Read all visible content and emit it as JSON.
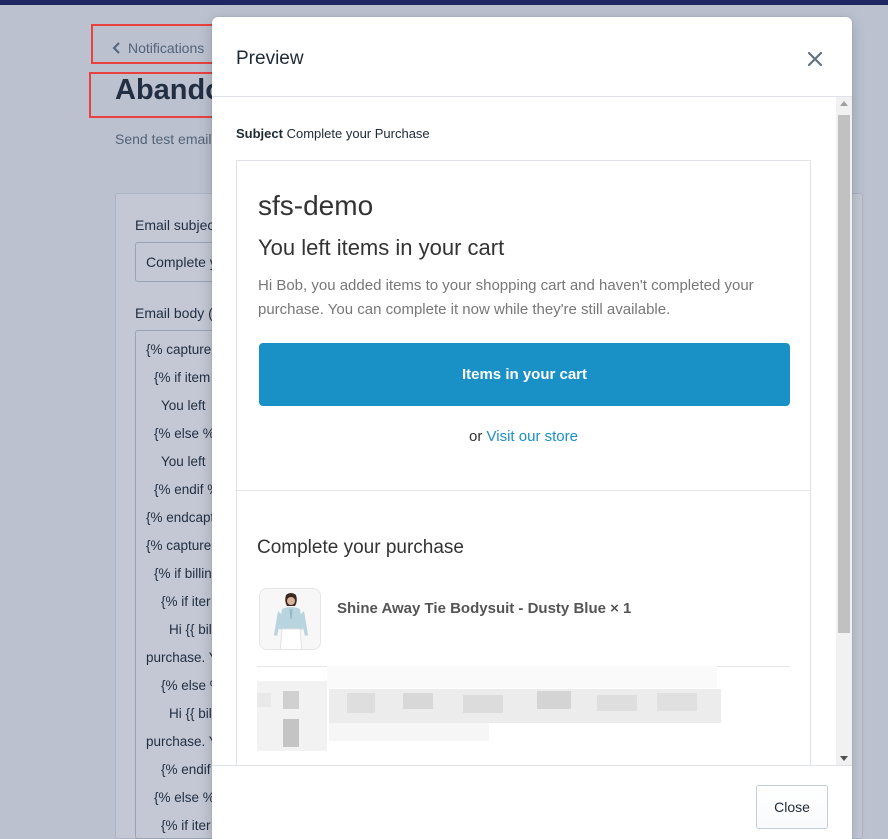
{
  "background": {
    "breadcrumb_label": "Notifications",
    "page_title": "Abando",
    "send_test_text": "Send test email",
    "email_subject_label": "Email subjec",
    "email_subject_value": "Complete y",
    "email_body_label": "Email body (",
    "code_lines": [
      "{% capture",
      "{% if item",
      "You left",
      "{% else %",
      "You left",
      "{% endif %",
      "{% endcapt",
      "{% capture",
      "{% if billin",
      "{% if iter",
      "Hi {{ bil",
      "purchase. Y",
      "{% else %",
      "Hi {{ bil",
      "purchase. Y",
      "{% endif",
      "{% else %",
      "{% if iter"
    ]
  },
  "modal": {
    "title": "Preview",
    "subject_prefix": "Subject",
    "subject_value": "Complete your Purchase",
    "email": {
      "shop_name": "sfs-demo",
      "heading": "You left items in your cart",
      "body_text": "Hi Bob, you added items to your shopping cart and haven't completed your purchase. You can complete it now while they're still available.",
      "button_label": "Items in your cart",
      "or_text": "or",
      "store_link": "Visit our store",
      "section_heading": "Complete your purchase",
      "product_title": "Shine Away Tie Bodysuit - Dusty Blue × 1"
    },
    "footer_close_label": "Close"
  },
  "colors": {
    "accent": "#1990c6",
    "annotation": "#e8413f",
    "topbar": "#1c2260"
  }
}
